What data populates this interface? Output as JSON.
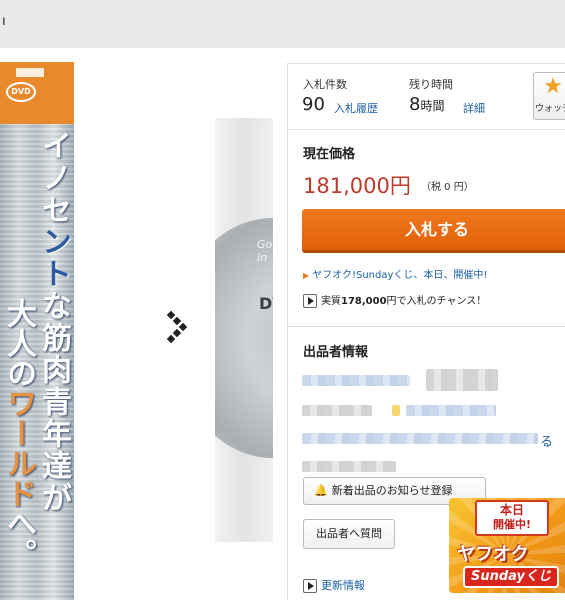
{
  "topbar": {
    "glyph": "ı"
  },
  "gallery": {
    "cover_badge": "DVD",
    "cover_title_line1": [
      "イノセ",
      "ン",
      "ト",
      "な筋肉青年達が"
    ],
    "cover_title_line2": [
      "大人の",
      "ワールド",
      "へ。"
    ],
    "disc_label": "Go! In",
    "disc_mark": "DVD",
    "next_icon": "chevron-right-icon"
  },
  "auction": {
    "bid_count_label": "入札件数",
    "bid_count": "90",
    "bid_history_link": "入札履歴",
    "time_left_label": "残り時間",
    "time_left_value": "8",
    "time_left_unit": "時間",
    "time_detail_link": "詳細",
    "watch_label": "ウォッチ",
    "price_label": "現在価格",
    "price": "181,000円",
    "price_tax": "（税 0 円）",
    "bid_button": "入札する",
    "promo_link": "ヤフオク!Sundayくじ、本日、開催中!",
    "chance_prefix": "実質",
    "chance_amount": "178,000",
    "chance_suffix": "円で入札のチャンス！"
  },
  "seller": {
    "title": "出品者情報",
    "partial_text": "る",
    "notify_button": "新着出品のお知らせ登録",
    "ask_button": "出品者へ質問",
    "update_link": "更新情報"
  },
  "banner": {
    "line1": "本日",
    "line2": "開催中!",
    "brand": "ヤフオク",
    "sunday": "Sundayくじ"
  },
  "colors": {
    "accent_orange": "#e0600a",
    "price_red": "#c0392b",
    "link_blue": "#1a5fa8",
    "topbar_gray": "#e9e9e7"
  }
}
